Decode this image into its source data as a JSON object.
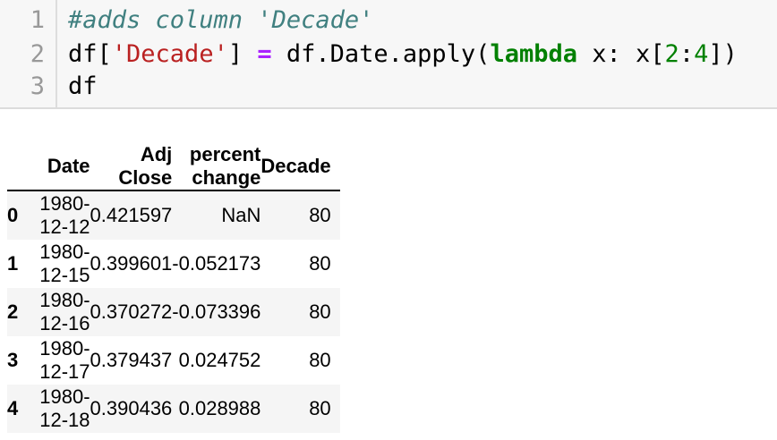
{
  "code_cell": {
    "line_numbers": [
      "1",
      "2",
      "3"
    ],
    "line1": {
      "comment": "#adds column 'Decade'"
    },
    "line2": {
      "t1": "df[",
      "t2": "'Decade'",
      "t3": "] ",
      "t4": "=",
      "t5": " df.Date.apply(",
      "t6": "lambda",
      "t7": " x: x[",
      "t8": "2",
      "t9": ":",
      "t10": "4",
      "t11": "])"
    },
    "line3": {
      "t1": "df"
    }
  },
  "output_table": {
    "columns": [
      "",
      "Date",
      "Adj Close",
      "percent change",
      "Decade"
    ],
    "rows": [
      {
        "index": "0",
        "date": "1980-12-12",
        "adj_close": "0.421597",
        "percent_change": "NaN",
        "decade": "80"
      },
      {
        "index": "1",
        "date": "1980-12-15",
        "adj_close": "0.399601",
        "percent_change": "-0.052173",
        "decade": "80"
      },
      {
        "index": "2",
        "date": "1980-12-16",
        "adj_close": "0.370272",
        "percent_change": "-0.073396",
        "decade": "80"
      },
      {
        "index": "3",
        "date": "1980-12-17",
        "adj_close": "0.379437",
        "percent_change": "0.024752",
        "decade": "80"
      },
      {
        "index": "4",
        "date": "1980-12-18",
        "adj_close": "0.390436",
        "percent_change": "0.028988",
        "decade": "80"
      }
    ]
  },
  "colors": {
    "comment": "#408080",
    "string": "#ba2121",
    "operator": "#aa22ff",
    "keyword": "#008000",
    "number": "#008000",
    "input_bg": "#f7f7f7",
    "row_stripe": "#f5f5f5"
  }
}
